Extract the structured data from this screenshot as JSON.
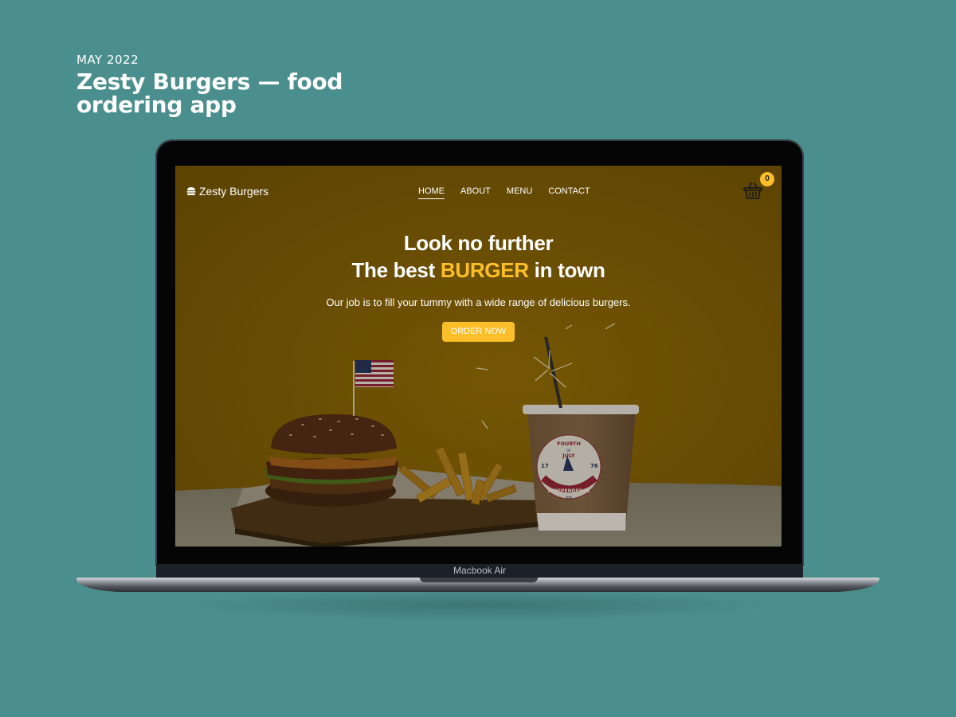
{
  "case": {
    "date": "MAY 2022",
    "title": "Zesty Burgers — food ordering app"
  },
  "device": {
    "label": "Macbook Air"
  },
  "site": {
    "brand": "Zesty Burgers",
    "nav": [
      {
        "label": "HOME",
        "active": true
      },
      {
        "label": "ABOUT"
      },
      {
        "label": "MENU"
      },
      {
        "label": "CONTACT"
      }
    ],
    "cart_count": "0"
  },
  "hero": {
    "line1": "Look no further",
    "line2_prefix": "The best ",
    "line2_highlight": "BURGER",
    "line2_suffix": " in town",
    "subtitle": "Our job is to fill your tummy with a wide range of delicious burgers.",
    "cta": "ORDER NOW"
  },
  "cup_sticker": {
    "top": "FOURTH OF JULY",
    "year_left": "17",
    "year_right": "76",
    "arc": "INDEPENDENCE",
    "bottom": "DAY"
  },
  "colors": {
    "page_bg": "#4a8f8d",
    "accent": "#fcbf29",
    "hero_bg": "#7a5b05"
  }
}
